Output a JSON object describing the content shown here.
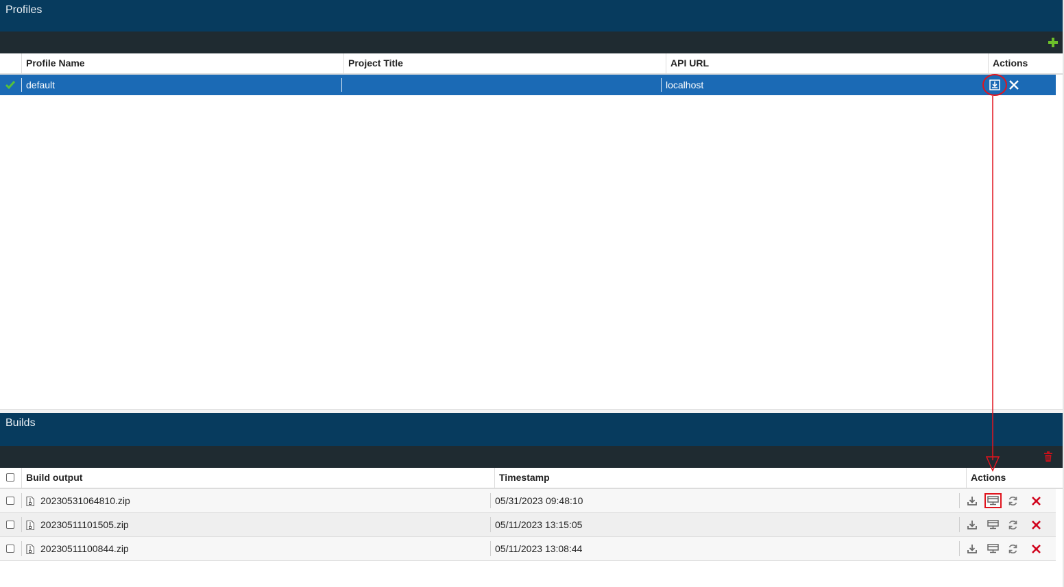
{
  "profiles": {
    "title": "Profiles",
    "columns": [
      "Profile Name",
      "Project Title",
      "API URL",
      "Actions"
    ],
    "rows": [
      {
        "profile_name": "default",
        "project_title": "",
        "api_url": "localhost"
      }
    ]
  },
  "builds": {
    "title": "Builds",
    "columns": [
      "Build output",
      "Timestamp",
      "Actions"
    ],
    "rows": [
      {
        "file": "20230531064810.zip",
        "timestamp": "05/31/2023 09:48:10"
      },
      {
        "file": "20230511101505.zip",
        "timestamp": "05/11/2023 13:15:05"
      },
      {
        "file": "20230511100844.zip",
        "timestamp": "05/11/2023 13:08:44"
      }
    ]
  },
  "colors": {
    "title_bar": "#073b5e",
    "toolbar": "#1f2b31",
    "selected_row": "#1b6ab5",
    "add_icon": "#6cbf2a",
    "delete_icon": "#d0021b",
    "annotation": "#e0141e"
  },
  "icons": {
    "profile_add": "plus-icon",
    "profile_active": "check-icon",
    "profile_build": "build-icon",
    "profile_delete": "close-icon",
    "builds_clear": "trash-icon",
    "build_download": "download-icon",
    "build_deploy": "deploy-icon",
    "build_rebuild": "refresh-icon",
    "build_delete": "delete-icon",
    "build_file": "zip-file-icon"
  }
}
